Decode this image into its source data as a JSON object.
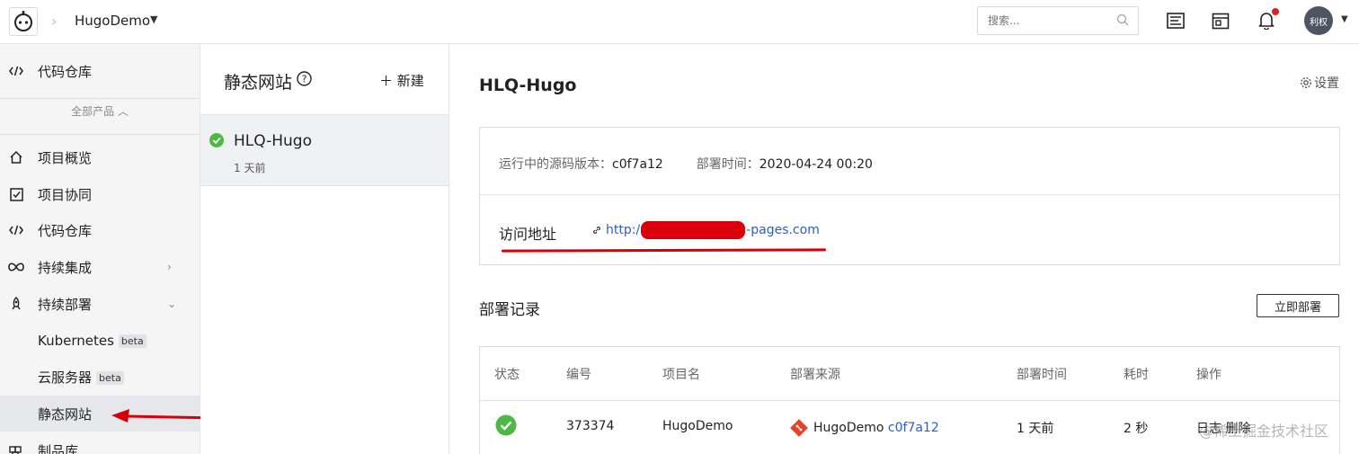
{
  "topbar": {
    "project": "HugoDemo",
    "search_placeholder": "搜索...",
    "avatar_text": "利权"
  },
  "sidebar": {
    "items": [
      {
        "label": "代码仓库",
        "icon": "code-icon"
      },
      {
        "label": "项目概览",
        "icon": "home-icon"
      },
      {
        "label": "项目协同",
        "icon": "checkbox-icon"
      },
      {
        "label": "代码仓库",
        "icon": "code-icon"
      },
      {
        "label": "持续集成",
        "icon": "infinity-icon"
      },
      {
        "label": "持续部署",
        "icon": "rocket-icon"
      },
      {
        "label": "Kubernetes",
        "badge": "beta"
      },
      {
        "label": "云服务器",
        "badge": "beta"
      },
      {
        "label": "静态网站"
      },
      {
        "label": "制品库",
        "icon": "package-icon"
      }
    ],
    "all_products": "全部产品"
  },
  "sites_panel": {
    "title": "静态网站",
    "new_label": "新建",
    "site_name": "HLQ-Hugo",
    "site_time": "1 天前"
  },
  "main": {
    "title": "HLQ-Hugo",
    "settings_label": "设置",
    "version_label": "运行中的源码版本：",
    "version_value": "c0f7a12",
    "deploy_time_label": "部署时间：",
    "deploy_time_value": "2020-04-24 00:20",
    "visit_label": "访问地址",
    "url_prefix": "http:/",
    "url_suffix": "-pages.com",
    "records_title": "部署记录",
    "deploy_now": "立即部署"
  },
  "table": {
    "columns": [
      "状态",
      "编号",
      "项目名",
      "部署来源",
      "部署时间",
      "耗时",
      "操作"
    ],
    "rows": [
      {
        "id": "373374",
        "project": "HugoDemo",
        "source": "HugoDemo",
        "sha": "c0f7a12",
        "time": "1 天前",
        "duration": "2 秒",
        "actions": "日志 删除"
      }
    ]
  },
  "watermark": "@稀土掘金技术社区",
  "colors": {
    "accent_blue": "#2c5ec4",
    "success_green": "#4cb944",
    "annotation_red": "#d6000a"
  }
}
